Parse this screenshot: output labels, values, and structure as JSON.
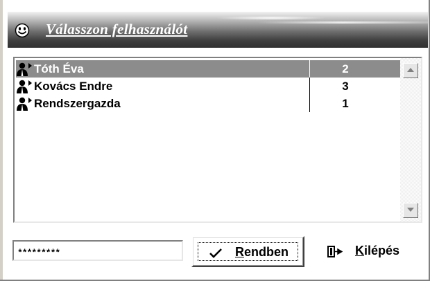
{
  "dialog": {
    "title": "Válasszon felhasználót",
    "title_icon": "smiley-icon"
  },
  "users": [
    {
      "name": "Tóth Éva",
      "count": "2",
      "selected": true,
      "icon": "user-icon"
    },
    {
      "name": "Kovács Endre",
      "count": "3",
      "selected": false,
      "icon": "user-icon"
    },
    {
      "name": "Rendszergazda",
      "count": "1",
      "selected": false,
      "icon": "user-icon"
    }
  ],
  "password": {
    "value": "*********"
  },
  "ok_button": {
    "label_accel": "R",
    "label_rest": "endben",
    "icon": "checkmark-icon"
  },
  "exit_button": {
    "label_accel": "K",
    "label_rest": "ilépés",
    "icon": "exit-door-icon"
  },
  "colors": {
    "selection": "#8c8c8c",
    "header_dark": "#303030",
    "header_light": "#f2f2f2"
  }
}
